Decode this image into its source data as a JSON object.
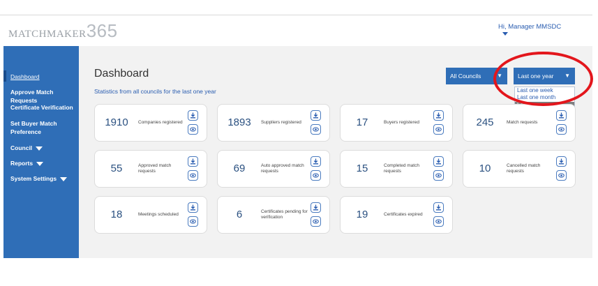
{
  "header": {
    "logo_text": "MATCHMAKER",
    "logo_number": "365",
    "greeting": "Hi, Manager MMSDC"
  },
  "sidebar": {
    "items": [
      {
        "label": "Dashboard",
        "active": true
      },
      {
        "label": "Approve Match Requests"
      },
      {
        "label": "Certificate Verification"
      },
      {
        "label": "Set Buyer Match Preference"
      },
      {
        "label": "Council",
        "has_caret": true
      },
      {
        "label": "Reports",
        "has_caret": true
      },
      {
        "label": "System Settings",
        "has_caret": true
      }
    ]
  },
  "main": {
    "title": "Dashboard",
    "subtitle": "Statistics from all councils for the last one year",
    "council_select": {
      "value": "All Councils"
    },
    "period_select": {
      "value": "Last one year",
      "options": [
        "Last one week",
        "Last one month",
        "Last one year"
      ],
      "selected_index": 2
    }
  },
  "stats": [
    {
      "value": "1910",
      "label": "Companies registered"
    },
    {
      "value": "1893",
      "label": "Suppliers registered"
    },
    {
      "value": "17",
      "label": "Buyers registered"
    },
    {
      "value": "245",
      "label": "Match requests"
    },
    {
      "value": "55",
      "label": "Approved match requests"
    },
    {
      "value": "69",
      "label": "Auto approved match requests"
    },
    {
      "value": "15",
      "label": "Completed match requests"
    },
    {
      "value": "10",
      "label": "Cancelled match requests"
    },
    {
      "value": "18",
      "label": "Meetings scheduled"
    },
    {
      "value": "6",
      "label": "Certificates pending for verification"
    },
    {
      "value": "19",
      "label": "Certificates expired"
    }
  ],
  "icons": {
    "download": "download-icon",
    "view": "eye-icon",
    "caret": "caret-down-icon"
  },
  "colors": {
    "sidebar": "#2f6eb7",
    "accent": "#2a5db0",
    "highlight_circle": "#e3161c"
  }
}
